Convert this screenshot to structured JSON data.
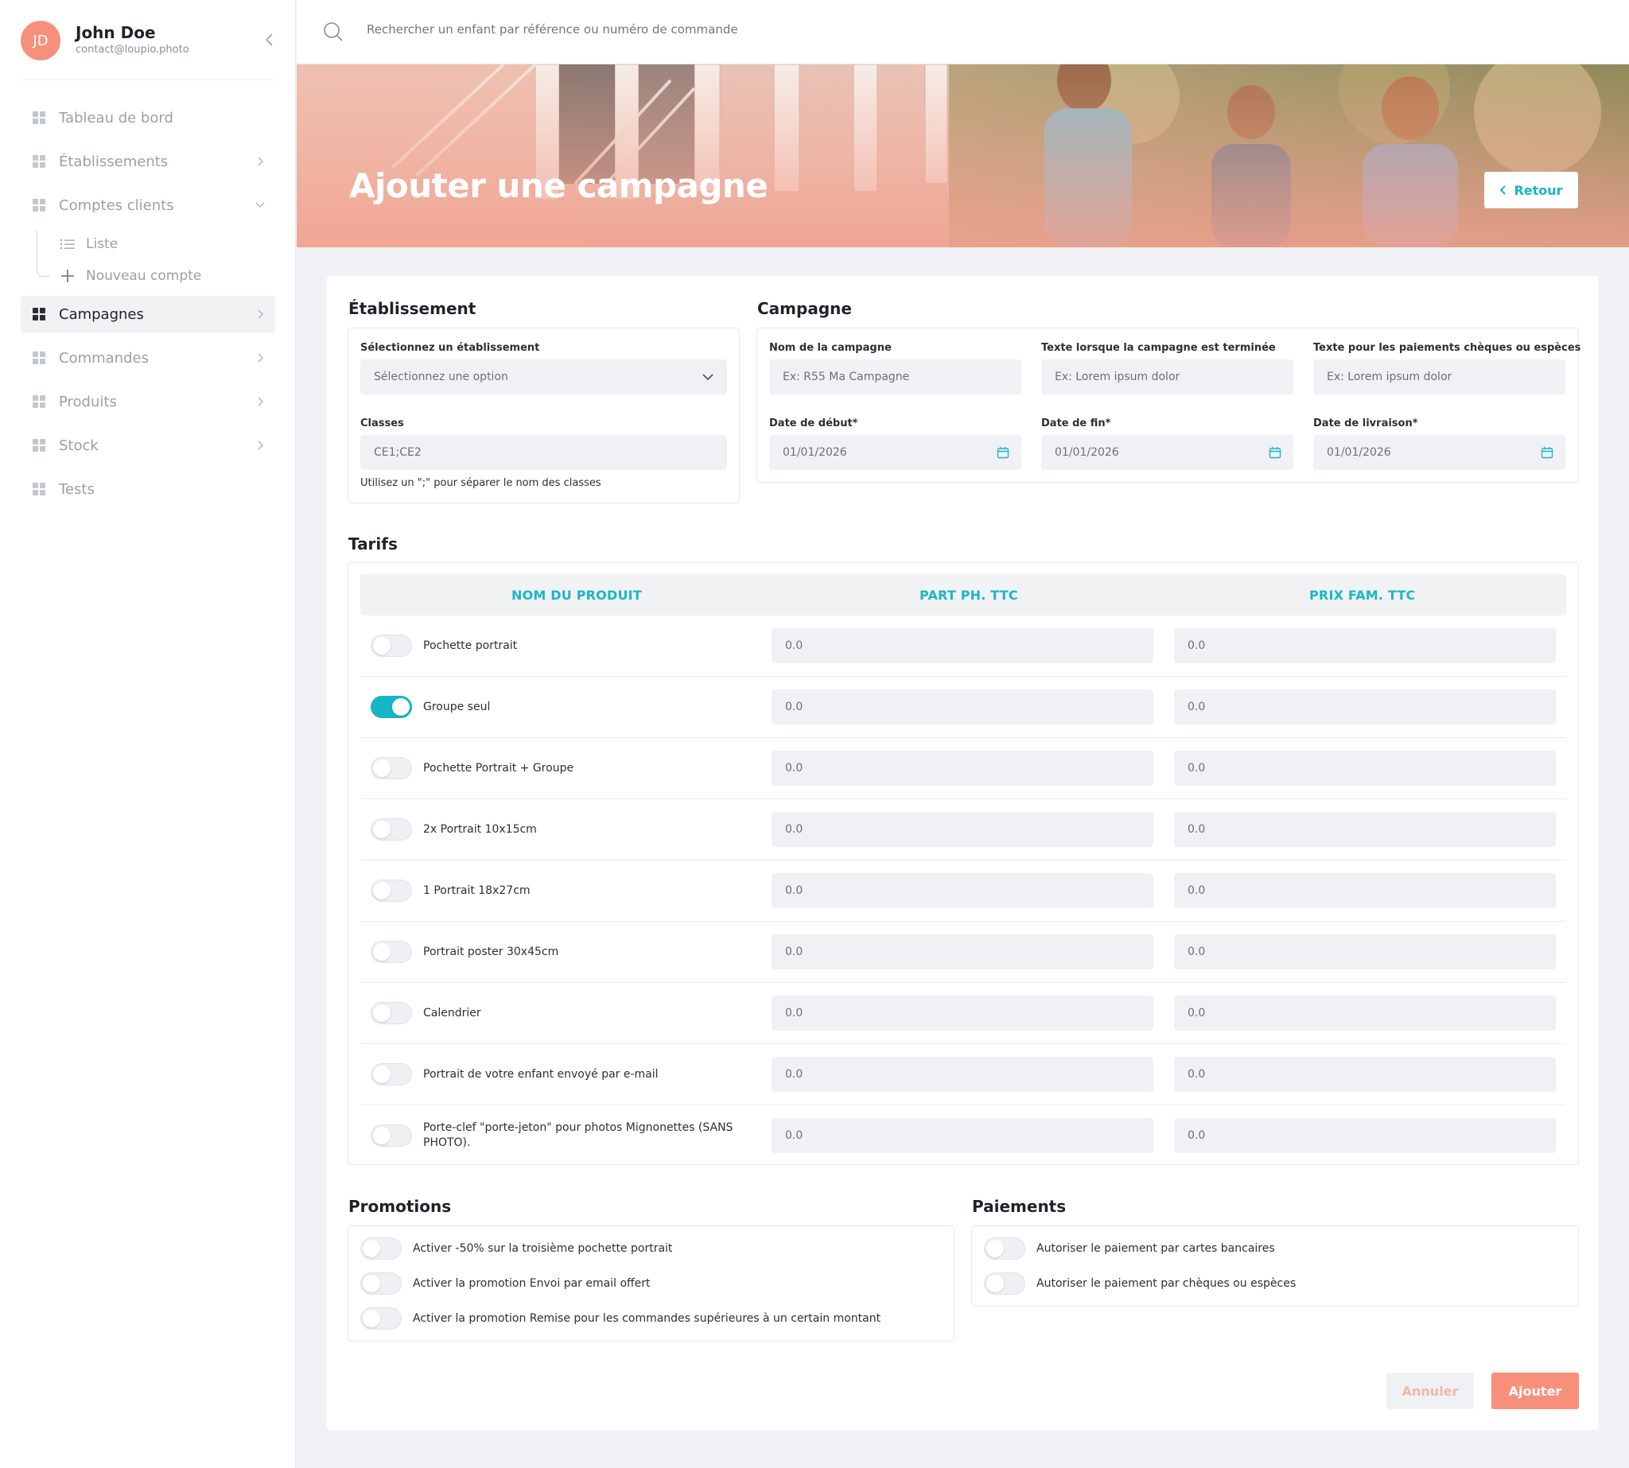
{
  "user": {
    "initials": "JD",
    "name": "John Doe",
    "email": "contact@loupio.photo"
  },
  "nav": {
    "items": [
      {
        "label": "Tableau de bord"
      },
      {
        "label": "Établissements"
      },
      {
        "label": "Comptes clients"
      },
      {
        "label": "Campagnes"
      },
      {
        "label": "Commandes"
      },
      {
        "label": "Produits"
      },
      {
        "label": "Stock"
      },
      {
        "label": "Tests"
      }
    ],
    "sub": [
      {
        "label": "Liste"
      },
      {
        "label": "Nouveau compte"
      }
    ]
  },
  "search": {
    "placeholder": "Rechercher un enfant par référence ou numéro de commande"
  },
  "hero": {
    "title": "Ajouter une campagne",
    "back_label": "Retour"
  },
  "etablissement": {
    "title": "Établissement",
    "select_label": "Sélectionnez un établissement",
    "select_value": "Sélectionnez une option",
    "classes_label": "Classes",
    "classes_value": "CE1;CE2",
    "classes_hint": "Utilisez un \";\" pour séparer le nom des classes"
  },
  "campagne": {
    "title": "Campagne",
    "name_label": "Nom de la campagne",
    "name_placeholder": "Ex: R55 Ma Campagne",
    "end_text_label": "Texte lorsque la campagne est terminée",
    "end_text_placeholder": "Ex: Lorem ipsum dolor",
    "cheque_text_label": "Texte pour les paiements chèques ou espèces",
    "cheque_text_placeholder": "Ex: Lorem ipsum dolor",
    "start_label": "Date de début*",
    "start_value": "01/01/2026",
    "end_label": "Date de fin*",
    "end_value": "01/01/2026",
    "delivery_label": "Date de livraison*",
    "delivery_value": "01/01/2026"
  },
  "tarifs": {
    "title": "Tarifs",
    "headers": [
      "NOM DU PRODUIT",
      "PART PH. TTC",
      "PRIX FAM. TTC"
    ],
    "rows": [
      {
        "name": "Pochette portrait",
        "part": "0.0",
        "prix": "0.0",
        "enabled": false
      },
      {
        "name": "Groupe seul",
        "part": "0.0",
        "prix": "0.0",
        "enabled": true
      },
      {
        "name": "Pochette Portrait + Groupe",
        "part": "0.0",
        "prix": "0.0",
        "enabled": false
      },
      {
        "name": "2x Portrait 10x15cm",
        "part": "0.0",
        "prix": "0.0",
        "enabled": false
      },
      {
        "name": "1 Portrait 18x27cm",
        "part": "0.0",
        "prix": "0.0",
        "enabled": false
      },
      {
        "name": "Portrait poster 30x45cm",
        "part": "0.0",
        "prix": "0.0",
        "enabled": false
      },
      {
        "name": "Calendrier",
        "part": "0.0",
        "prix": "0.0",
        "enabled": false
      },
      {
        "name": "Portrait de votre enfant envoyé par e-mail",
        "part": "0.0",
        "prix": "0.0",
        "enabled": false
      },
      {
        "name": "Porte-clef \"porte-jeton\" pour photos Mignonettes (SANS PHOTO).",
        "part": "0.0",
        "prix": "0.0",
        "enabled": false
      }
    ]
  },
  "promotions": {
    "title": "Promotions",
    "items": [
      {
        "label": "Activer -50% sur la troisième pochette portrait"
      },
      {
        "label": "Activer la promotion Envoi par email offert"
      },
      {
        "label": "Activer la promotion Remise pour les commandes supérieures à un certain montant"
      }
    ]
  },
  "paiements": {
    "title": "Paiements",
    "items": [
      {
        "label": "Autoriser le paiement par cartes bancaires"
      },
      {
        "label": "Autoriser le paiement par chèques ou espèces"
      }
    ]
  },
  "actions": {
    "cancel_label": "Annuler",
    "submit_label": "Ajouter"
  },
  "colors": {
    "accent": "#16b6c6",
    "brand": "#f7907a"
  }
}
